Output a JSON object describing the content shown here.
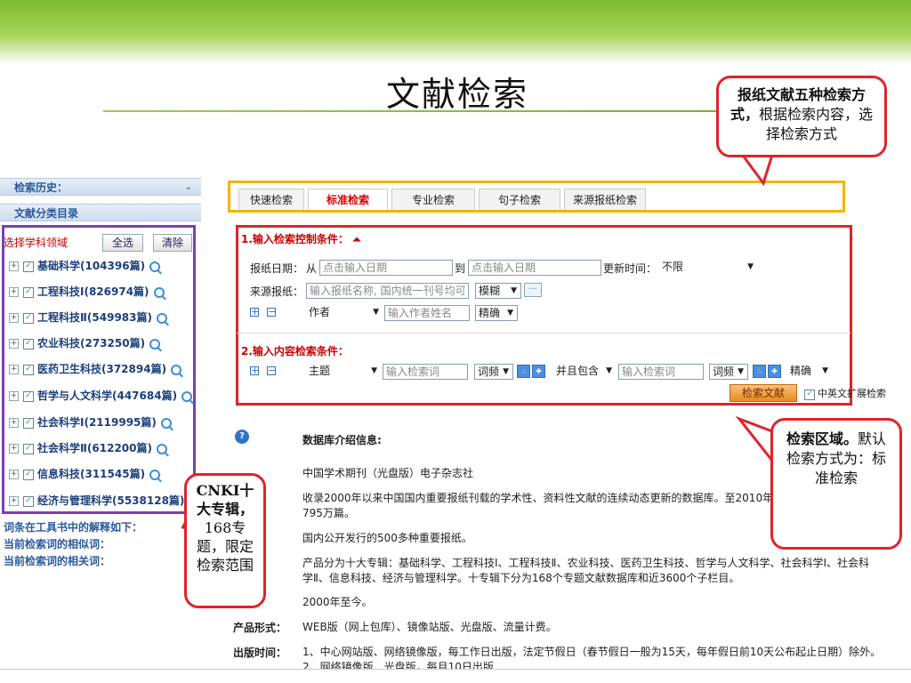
{
  "slide": {
    "title": "文献检索"
  },
  "sidebar": {
    "history": "检索历史：",
    "history_toggle": "⌄",
    "catalog": "文献分类目录",
    "select_label": "选择学科领域",
    "select_all": "全选",
    "clear": "清除",
    "subjects": [
      "基础科学(104396篇)",
      "工程科技Ⅰ(826974篇)",
      "工程科技Ⅱ(549983篇)",
      "农业科技(273250篇)",
      "医药卫生科技(372894篇)",
      "哲学与人文科学(447684篇)",
      "社会科学Ⅰ(2119995篇)",
      "社会科学Ⅱ(612200篇)",
      "信息科技(311545篇)",
      "经济与管理科学(5538128篇)"
    ],
    "links": [
      "词条在工具书中的解释如下：",
      "当前检索词的相似词：",
      "当前检索词的相关词："
    ]
  },
  "tabs": [
    "快速检索",
    "标准检索",
    "专业检索",
    "句子检索",
    "来源报纸检索"
  ],
  "active_tab": "标准检索",
  "control": {
    "section1": "1.输入检索控制条件：",
    "date_label": "报纸日期：",
    "date_from": "从",
    "date_from_placeholder": "点击输入日期",
    "date_to": "到",
    "date_to_placeholder": "点击输入日期",
    "update_label": "更新时间：",
    "update_value": "不限",
    "source_label": "来源报纸：",
    "source_placeholder": "输入报纸名称, 国内统一刊号均可",
    "source_match": "模糊",
    "more": "···",
    "author_field": "作者",
    "author_placeholder": "输入作者姓名",
    "author_match": "精确",
    "section2": "2.输入内容检索条件：",
    "topic_field": "主题",
    "kw1_placeholder": "输入检索词",
    "freq1": "词频",
    "logic": "并且包含",
    "kw2_placeholder": "输入检索词",
    "freq2": "词频",
    "match2": "精确",
    "search_button": "检索文献",
    "extend_label": "中英文扩展检索"
  },
  "info": {
    "heading": "数据库介绍信息:",
    "publisher": "中国学术期刊（光盘版）电子杂志社",
    "scope": "收录2000年以来中国国内重要报纸刊载的学术性、资料性文献的连续动态更新的数据库。至2010年",
    "scope2": "795万篇。",
    "sources": "国内公开发行的500多种重要报纸。",
    "classification": "产品分为十大专辑：基础科学、工程科技Ⅰ、工程科技Ⅱ、农业科技、医药卫生科技、哲学与人文科学、社会科学Ⅰ、社会科",
    "classification2": "学Ⅱ、信息科技、经济与管理科学。十专辑下分为168个专题文献数据库和近3600个子栏目。",
    "years": "2000年至今。",
    "form_label": "产品形式：",
    "form": "WEB版（网上包库）、镜像站版、光盘版、流量计费。",
    "time_label": "出版时间：",
    "time1": "1、中心网站版、网络镜像版，每工作日出版，法定节假日（春节假日一般为15天，每年假日前10天公布起止日期）除外。",
    "time2": "2、网络镜像版、光盘版，每月10日出版"
  },
  "callouts": {
    "top_bold": "报纸文献五种检索方式，",
    "top_rest": "根据检索内容，选择检索方式",
    "right_bold": "检索区域。",
    "right_rest": "默认检索方式为：标准检索",
    "left_bold": "CNKI十大专辑，",
    "left_rest": "168专题，限定检索范围"
  }
}
